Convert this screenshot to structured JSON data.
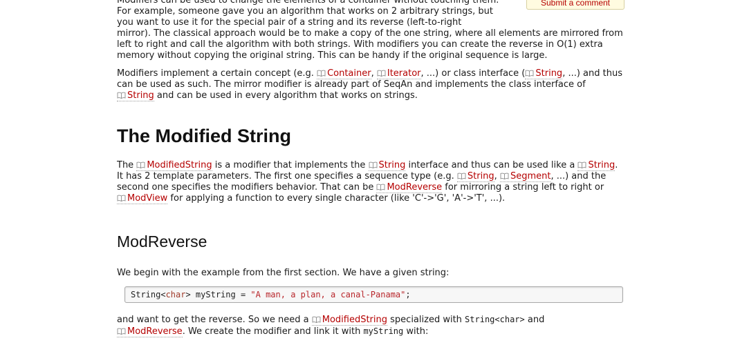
{
  "submit_comment": "Submit a comment",
  "intro": {
    "narrow": "Modifiers can be used to change the elements of a container without touching them. For example, someone gave you an algorithm that works on 2 arbitrary strings, but you want to use it for the special pair of a string and its reverse (left-to-right",
    "rest": "mirror). The classical approach would be to make a copy of the one string, where all elements are mirrored from left to right and call the algorithm with both strings. With modifiers you can create the reverse in O(1) extra memory without copying the original string. This can be handy if the original sequence is large."
  },
  "concept": {
    "t1": "Modifiers implement a certain concept (e.g. ",
    "ref_container": "Container",
    "t2": ", ",
    "ref_iterator": "Iterator",
    "t3": ", ...) or class interface (",
    "ref_string": "String",
    "t4": ", ...) and thus can be used as such. The mirror modifier is already part of SeqAn and implements the class interface of ",
    "ref_string2": "String",
    "t5": " and can be used in every algorithm that works on strings."
  },
  "modified_string": {
    "heading": "The Modified String",
    "t1": "The ",
    "ref_modifiedstring": "ModifiedString",
    "t2": " is a modifier that implements the ",
    "ref_string": "String",
    "t3": " interface and thus can be used like a ",
    "ref_string2": "String",
    "t4": ". It has 2 template parameters. The first one specifies a sequence type (e.g. ",
    "ref_string3": "String",
    "t5": ", ",
    "ref_segment": "Segment",
    "t6": ", ...) and the second one specifies the modifiers behavior. That can be ",
    "ref_modreverse": "ModReverse",
    "t7": " for mirroring a string left to right or ",
    "ref_modview": "ModView",
    "t8": " for applying a function to every single character (like 'C'->'G', 'A'->'T', ...)."
  },
  "modreverse": {
    "heading": "ModReverse",
    "intro": "We begin with the example from the first section. We have a given string:",
    "code": {
      "a": "String<",
      "b": "char",
      "c": "> myString = ",
      "d": "\"A man, a plan, a canal-Panama\"",
      "e": ";"
    },
    "t1": "and want to get the reverse. So we need a ",
    "ref_modifiedstring": "ModifiedString",
    "t2": " specialized with ",
    "code_inline": "String<char>",
    "t3": " and",
    "ref_modreverse": "ModReverse",
    "t4": ". We create the modifier and link it with ",
    "code_inline2": "myString",
    "t5": " with:"
  }
}
